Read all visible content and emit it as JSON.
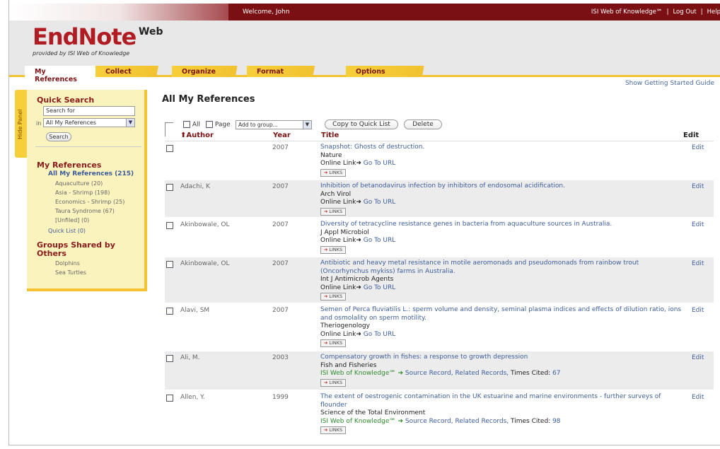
{
  "topbar": {
    "welcome": "Welcome, John",
    "isi_link": "ISI Web of Knowledge℠",
    "logout": "Log Out",
    "help": "Help"
  },
  "logo": {
    "main": "EndNote",
    "web": "Web",
    "sub": "provided by ISI Web of Knowledge"
  },
  "tabs": [
    "My References",
    "Collect",
    "Organize",
    "Format",
    "Options"
  ],
  "getting_started": "Show Getting Started Guide",
  "hide_panel": "Hide Panel",
  "quick_search": {
    "title": "Quick Search",
    "placeholder": "Search for",
    "in_label": "in",
    "scope": "All My References",
    "button": "Search"
  },
  "my_references": {
    "title": "My References",
    "all": "All My References (215)",
    "groups": [
      "Aquaculture (20)",
      "Asia - Shrimp (198)",
      "Economics - Shrimp (25)",
      "Taura Syndrome (67)",
      "[Unfiled] (0)"
    ],
    "quick_list": "Quick List (0)"
  },
  "shared": {
    "title": "Groups Shared by Others",
    "groups": [
      "Dolphins",
      "Sea Turtles"
    ]
  },
  "main": {
    "title": "All My References",
    "check_all": "All",
    "check_page": "Page",
    "add_to_group": "Add to group...",
    "copy_btn": "Copy to Quick List",
    "delete_btn": "Delete",
    "col_author": "Author",
    "col_year": "Year",
    "col_title": "Title",
    "col_edit": "Edit"
  },
  "common": {
    "online_link": "Online Link",
    "go_to_url": "Go To URL",
    "links": "LINKS",
    "edit": "Edit",
    "isi": "ISI Web of Knowledge℠",
    "source_record": "Source Record",
    "related_records": "Related Records",
    "times_cited": "Times Cited:"
  },
  "references": [
    {
      "author": "",
      "year": "2007",
      "title": "Snapshot: Ghosts of destruction.",
      "journal": "Nature"
    },
    {
      "author": "Adachi, K",
      "year": "2007",
      "title": "Inhibition of betanodavirus infection by inhibitors of endosomal acidification.",
      "journal": "Arch Virol"
    },
    {
      "author": "Akinbowale, OL",
      "year": "2007",
      "title": "Diversity of tetracycline resistance genes in bacteria from aquaculture sources in Australia.",
      "journal": "J Appl Microbiol"
    },
    {
      "author": "Akinbowale, OL",
      "year": "2007",
      "title": "Antibiotic and heavy metal resistance in motile aeromonads and pseudomonads from rainbow trout (Oncorhynchus mykiss) farms in Australia.",
      "journal": "Int J Antimicrob Agents"
    },
    {
      "author": "Alavi, SM",
      "year": "2007",
      "title": "Semen of Perca fluviatilis L.: sperm volume and density, seminal plasma indices and effects of dilution ratio, ions and osmolality on sperm motility.",
      "journal": "Theriogenology"
    },
    {
      "author": "Ali, M.",
      "year": "2003",
      "title": "Compensatory growth in fishes: a response to growth depression",
      "journal": "Fish and Fisheries",
      "times_cited": "67"
    },
    {
      "author": "Allen, Y.",
      "year": "1999",
      "title": "The extent of oestrogenic contamination in the UK estuarine and marine environments - further surveys of flounder",
      "journal": "Science of the Total Environment",
      "times_cited": "98"
    }
  ]
}
